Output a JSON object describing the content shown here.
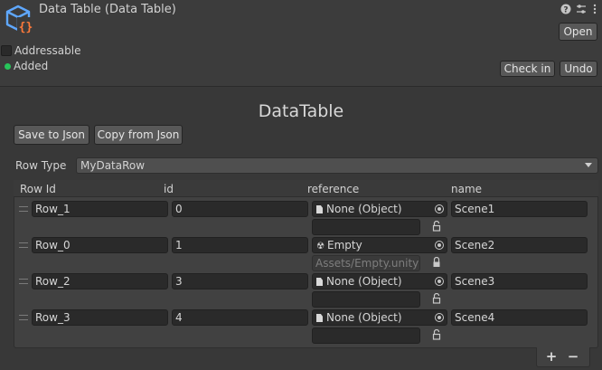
{
  "header": {
    "title": "Data Table (Data Table)",
    "icons": [
      "help-icon",
      "preset-icon",
      "more-icon"
    ],
    "open_label": "Open",
    "check_in_label": "Check in",
    "undo_label": "Undo"
  },
  "addressable": {
    "label": "Addressable",
    "checked": false
  },
  "vcs_status": {
    "label": "Added",
    "color": "#27c45a"
  },
  "inspector": {
    "title": "DataTable",
    "save_to_json_label": "Save to Json",
    "copy_from_json_label": "Copy from Json",
    "row_type_label": "Row Type",
    "row_type_value": "MyDataRow"
  },
  "table": {
    "columns": [
      "Row Id",
      "id",
      "reference",
      "name"
    ],
    "rows": [
      {
        "row_id": "Row_1",
        "id": "0",
        "reference": "None (Object)",
        "ref_icon": "document-icon",
        "path": "",
        "name": "Scene1"
      },
      {
        "row_id": "Row_0",
        "id": "1",
        "reference": "Empty",
        "ref_icon": "unity-scene-icon",
        "path": "Assets/Empty.unity",
        "name": "Scene2"
      },
      {
        "row_id": "Row_2",
        "id": "3",
        "reference": "None (Object)",
        "ref_icon": "document-icon",
        "path": "",
        "name": "Scene3"
      },
      {
        "row_id": "Row_3",
        "id": "4",
        "reference": "None (Object)",
        "ref_icon": "document-icon",
        "path": "",
        "name": "Scene4"
      }
    ],
    "add_label": "+",
    "remove_label": "−"
  }
}
